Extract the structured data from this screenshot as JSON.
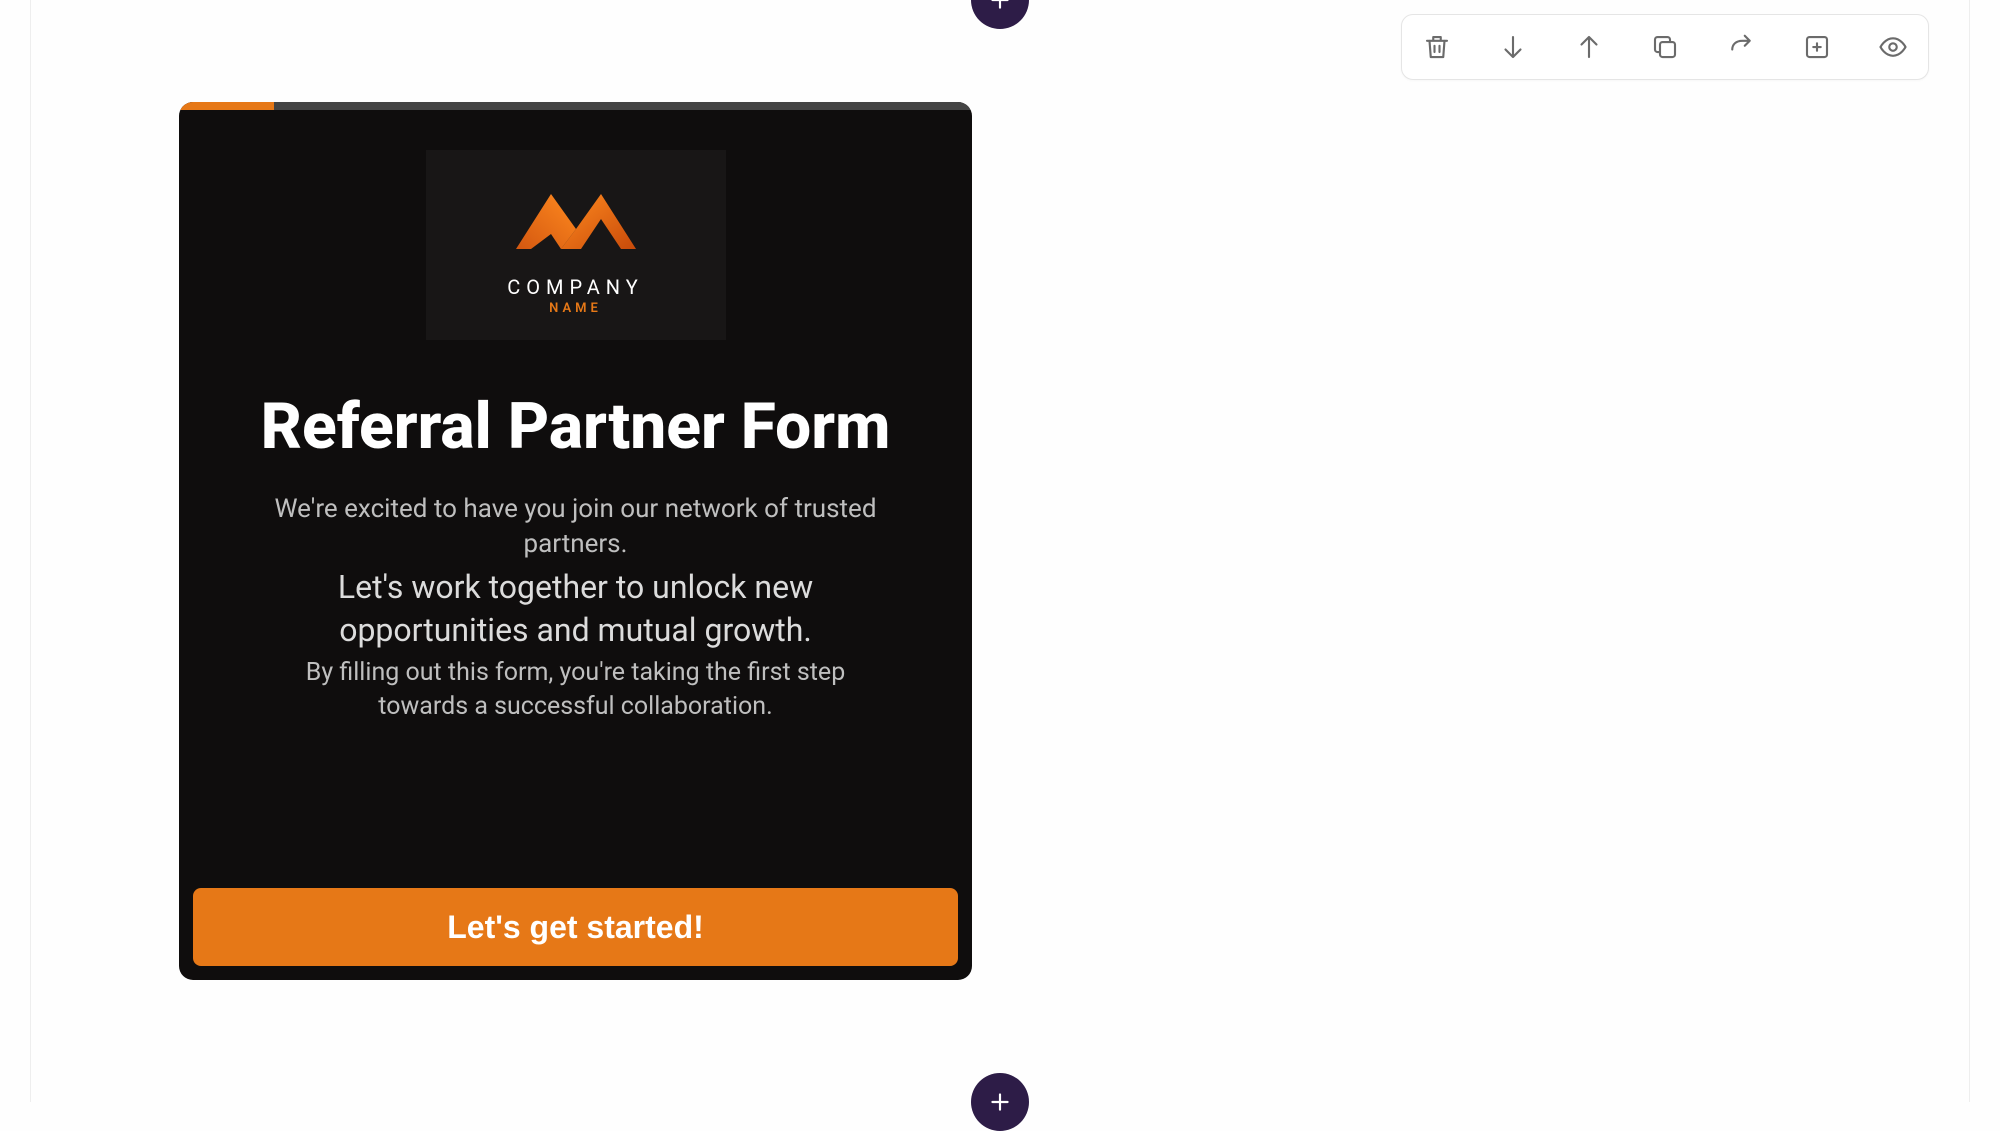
{
  "logo": {
    "company": "COMPANY",
    "name": "NAME"
  },
  "card": {
    "title": "Referral Partner Form",
    "intro": "We're excited to have you join our network of trusted partners.",
    "emphasis": "Let's work together to unlock new opportunities and mutual growth.",
    "sub": "By filling out this form, you're taking the first step towards a successful collaboration.",
    "cta": "Let's get started!"
  }
}
